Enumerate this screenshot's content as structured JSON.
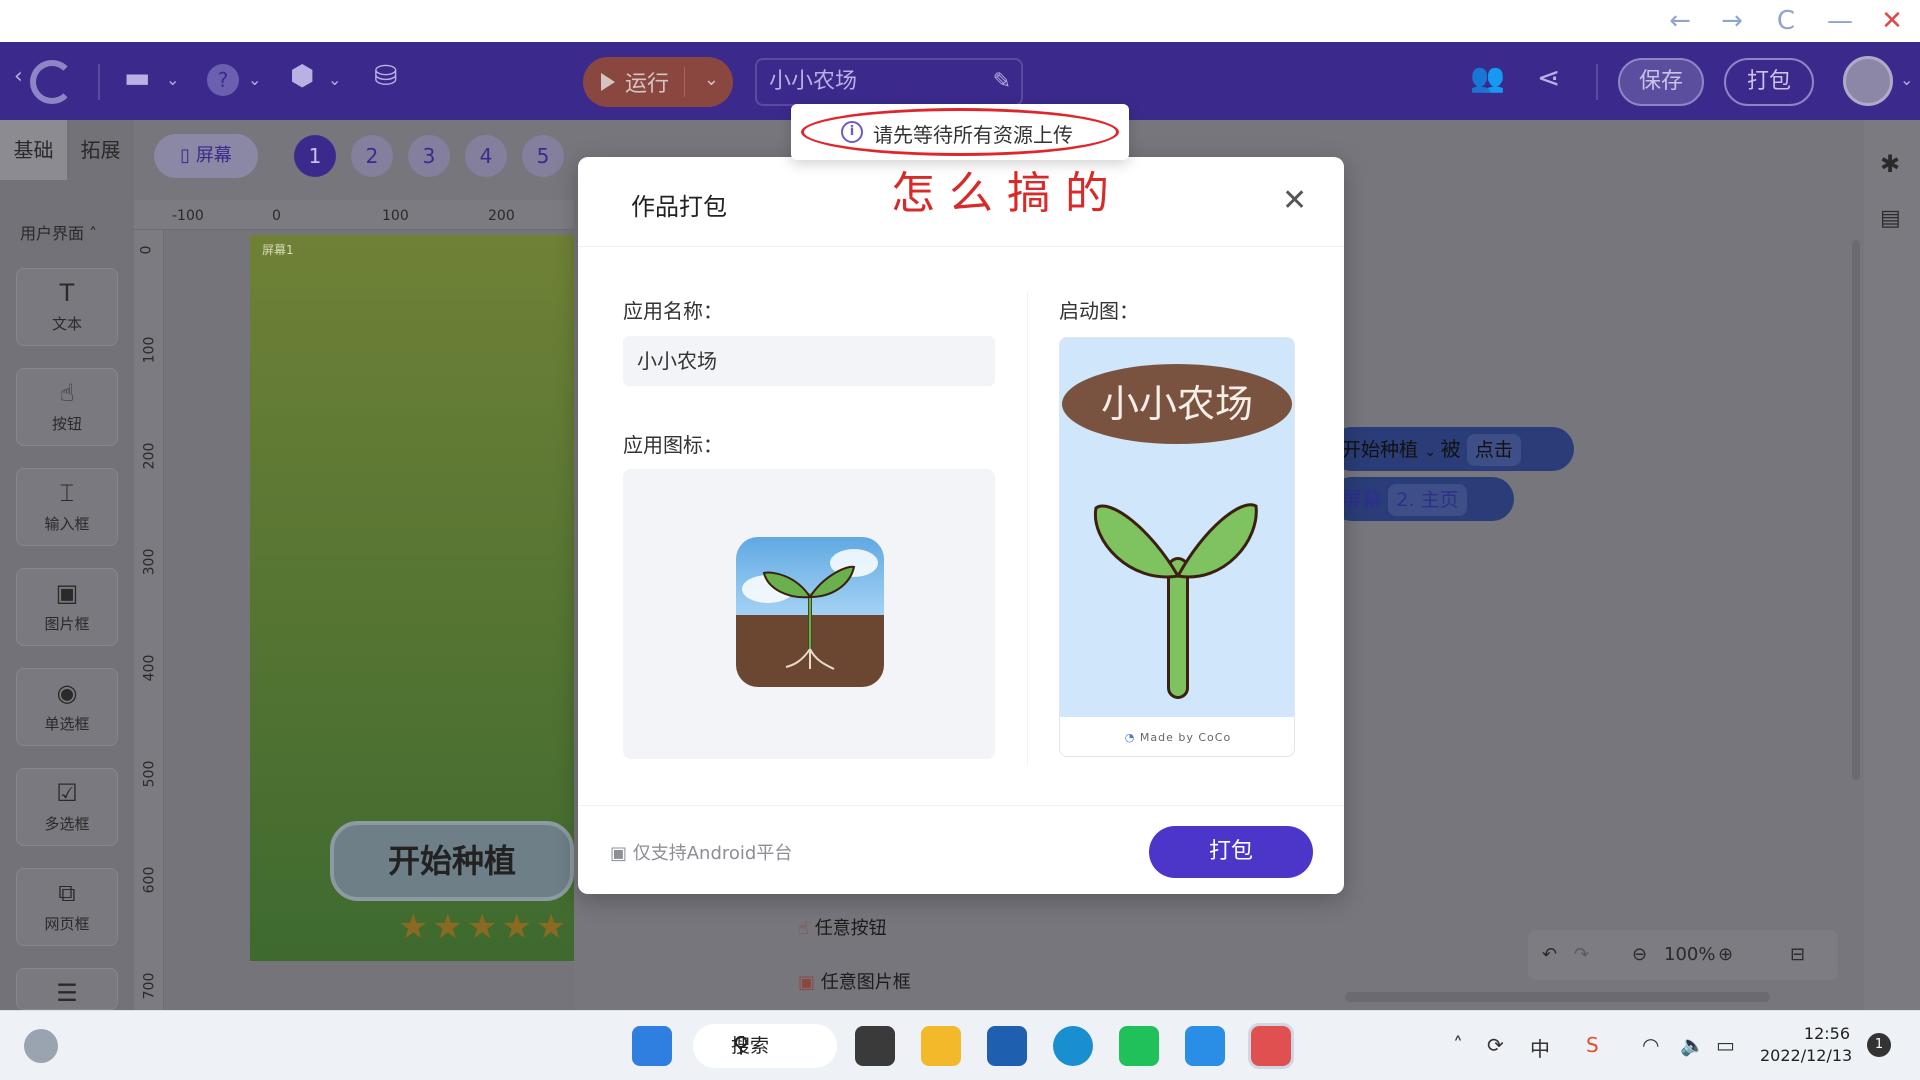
{
  "window": {
    "back": "←",
    "forward": "→",
    "refresh": "C",
    "minimize": "—",
    "close": "✕"
  },
  "header": {
    "run_label": "运行",
    "project_name": "小小农场",
    "save_label": "保存",
    "pack_label": "打包",
    "help_label": "?"
  },
  "leftbar": {
    "tabs": [
      {
        "label": "基础"
      },
      {
        "label": "拓展"
      }
    ],
    "section_label": "用户界面",
    "tools": [
      {
        "label": "文本",
        "icon": "T"
      },
      {
        "label": "按钮",
        "icon": "☝"
      },
      {
        "label": "输入框",
        "icon": "⌶"
      },
      {
        "label": "图片框",
        "icon": "▣"
      },
      {
        "label": "单选框",
        "icon": "◉"
      },
      {
        "label": "多选框",
        "icon": "☑"
      },
      {
        "label": "网页框",
        "icon": "⧉"
      }
    ]
  },
  "editor": {
    "screen_label": "屏幕",
    "pages": [
      "1",
      "2",
      "3",
      "4",
      "5"
    ],
    "ruler_h": [
      "-100",
      "0",
      "100",
      "200"
    ],
    "ruler_v": [
      "0",
      "100",
      "200",
      "300",
      "400",
      "500",
      "600",
      "700"
    ],
    "screen_name": "屏幕1",
    "start_button": "开始种植",
    "stars": "★★★★★"
  },
  "blocks": {
    "event_target": "开始种植",
    "event_word": "被",
    "event_action": "点击",
    "screen_word": "屏幕",
    "screen_target": "2. 主页",
    "palette": [
      "任意按钮",
      "任意图片框"
    ]
  },
  "zoom": {
    "value": "100%"
  },
  "modal": {
    "title": "作品打包",
    "annotation": "怎么搞的",
    "app_name_label": "应用名称：",
    "app_name_value": "小小农场",
    "app_icon_label": "应用图标：",
    "splash_label": "启动图：",
    "splash_sign": "小小农场",
    "splash_footer": "Made by CoCo",
    "platform_note": "仅支持Android平台",
    "pack_button": "打包"
  },
  "toast": {
    "message": "请先等待所有资源上传"
  },
  "taskbar": {
    "search_label": "搜索",
    "input_method": "中",
    "time": "12:56",
    "date": "2022/12/13",
    "notification_count": "1"
  },
  "colors": {
    "header_purple": "#3b2a8c",
    "primary_button": "#4c36c9",
    "run_button": "#8a4740",
    "annotation_red": "#d92a2a"
  }
}
